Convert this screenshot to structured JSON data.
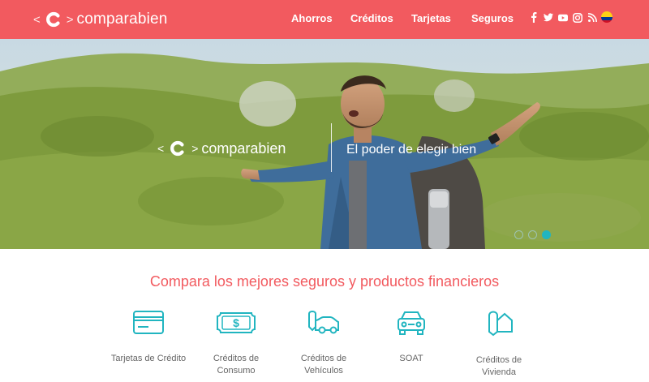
{
  "brand": {
    "name": "comparabien",
    "bracket_left": "<",
    "bracket_right": ">"
  },
  "nav": [
    "Ahorros",
    "Créditos",
    "Tarjetas",
    "Seguros"
  ],
  "social_icons": [
    "facebook-icon",
    "twitter-icon",
    "youtube-icon",
    "instagram-icon",
    "rss-icon"
  ],
  "country_flag": "colombia",
  "hero": {
    "tagline": "El poder de elegir bien",
    "slides_total": 3,
    "active_slide": 3
  },
  "products_section": {
    "title": "Compara los mejores seguros y productos financieros",
    "items": [
      {
        "label": "Tarjetas de Crédito",
        "icon": "credit-card-icon"
      },
      {
        "label": "Créditos de Consumo",
        "icon": "money-bill-icon"
      },
      {
        "label": "Créditos de Vehículos",
        "icon": "car-key-icon"
      },
      {
        "label": "SOAT",
        "icon": "car-front-icon"
      },
      {
        "label": "Créditos de Vivienda",
        "icon": "house-key-icon"
      }
    ]
  },
  "colors": {
    "header": "#f25a5f",
    "accent": "#21b5c0",
    "title": "#f25a5f"
  }
}
